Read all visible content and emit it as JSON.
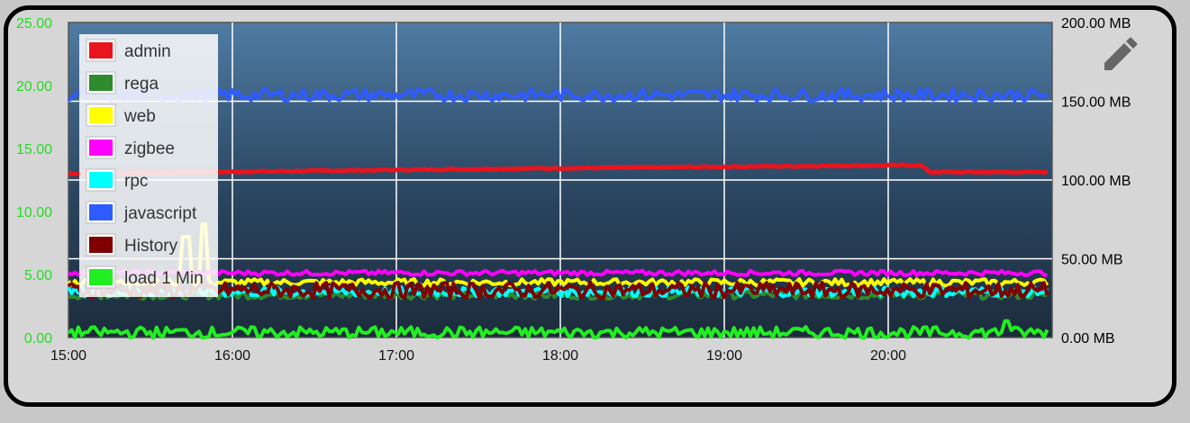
{
  "chart_data": {
    "type": "line",
    "x_ticks": [
      "15:00",
      "16:00",
      "17:00",
      "18:00",
      "19:00",
      "20:00"
    ],
    "x_range": [
      0,
      5.97
    ],
    "y_left": {
      "range": [
        0,
        25
      ],
      "ticks": [
        "0.00",
        "5.00",
        "10.00",
        "15.00",
        "20.00",
        "25.00"
      ],
      "color": "#22dd22"
    },
    "y_right": {
      "range": [
        0,
        200
      ],
      "ticks": [
        "0.00 MB",
        "50.00 MB",
        "100.00 MB",
        "150.00 MB",
        "200.00 MB"
      ],
      "color": "#000000"
    },
    "grid": true,
    "legend_position": "top-left",
    "series": [
      {
        "name": "admin",
        "color": "#e8141e",
        "axis": "right",
        "base": 104,
        "jitter": 0.4,
        "trend": [
          [
            0,
            104
          ],
          [
            2.5,
            107
          ],
          [
            5.2,
            109.5
          ],
          [
            5.25,
            105
          ],
          [
            5.97,
            105
          ]
        ]
      },
      {
        "name": "rega",
        "color": "#2e8b2e",
        "axis": "right",
        "base": 27,
        "jitter": 2.5
      },
      {
        "name": "web",
        "color": "#ffff00",
        "axis": "right",
        "base": 35,
        "jitter": 2.2,
        "spikes": [
          [
            0.72,
            64
          ],
          [
            0.83,
            72
          ]
        ]
      },
      {
        "name": "zigbee",
        "color": "#ff00ff",
        "axis": "right",
        "base": 41,
        "jitter": 1.5
      },
      {
        "name": "rpc",
        "color": "#00ffff",
        "axis": "right",
        "base": 29,
        "jitter": 3
      },
      {
        "name": "javascript",
        "color": "#2f5bff",
        "axis": "right",
        "base": 154,
        "jitter": 4
      },
      {
        "name": "History",
        "color": "#800000",
        "axis": "right",
        "base": 30,
        "jitter": 5
      },
      {
        "name": "load 1 Min",
        "color": "#22ee22",
        "axis": "left",
        "base": 0.4,
        "jitter": 0.45,
        "spikes": [
          [
            5.72,
            1.3
          ]
        ]
      }
    ]
  },
  "controls": {
    "edit_icon": "pencil-icon"
  }
}
